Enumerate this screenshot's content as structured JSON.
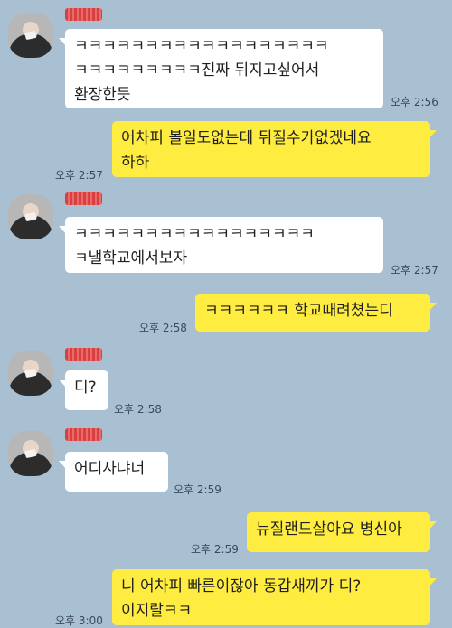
{
  "messages": [
    {
      "id": "m1",
      "side": "in",
      "sender": "redacted-name",
      "lines": [
        "ㅋㅋㅋㅋㅋㅋㅋㅋㅋㅋㅋㅋㅋㅋㅋㅋㅋㅋ",
        "ㅋㅋㅋㅋㅋㅋㅋㅋㅋ진짜 뒤지고싶어서",
        "환장한듯"
      ],
      "time": "오후 2:56"
    },
    {
      "id": "m2",
      "side": "out",
      "lines": [
        "어차피 볼일도없는데 뒤질수가없겠네요",
        "하하"
      ],
      "time": "오후 2:57"
    },
    {
      "id": "m3",
      "side": "in",
      "sender": "redacted-name",
      "lines": [
        "ㅋㅋㅋㅋㅋㅋㅋㅋㅋㅋㅋㅋㅋㅋㅋㅋㅋ",
        "ㅋ낼학교에서보자"
      ],
      "time": "오후 2:57"
    },
    {
      "id": "m4",
      "side": "out",
      "lines": [
        "ㅋㅋㅋㅋㅋㅋ 학교때려쳤는디"
      ],
      "time": "오후 2:58"
    },
    {
      "id": "m5",
      "side": "in",
      "sender": "redacted-name",
      "lines": [
        "디?"
      ],
      "time": "오후 2:58"
    },
    {
      "id": "m6",
      "side": "in",
      "sender": "redacted-name",
      "lines": [
        "어디사냐너"
      ],
      "time": "오후 2:59"
    },
    {
      "id": "m7",
      "side": "out",
      "lines": [
        "뉴질랜드살아요 병신아"
      ],
      "time": "오후 2:59"
    },
    {
      "id": "m8",
      "side": "out",
      "lines": [
        "니 어차피 빠른이잖아 동갑새끼가 디?",
        "이지랄ㅋㅋ"
      ],
      "time": "오후 3:00"
    }
  ],
  "colors": {
    "background": "#a9c0d3",
    "incoming_bubble": "#ffffff",
    "outgoing_bubble": "#ffec41"
  }
}
